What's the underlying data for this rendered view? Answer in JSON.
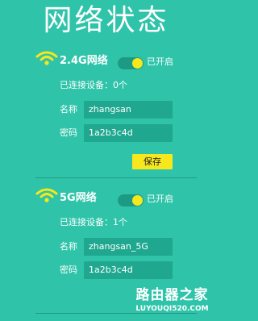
{
  "page": {
    "title": "网络状态"
  },
  "networks": [
    {
      "band_label": "2.4G网络",
      "toggle_status": "已开启",
      "enabled": true,
      "connected_devices": "已连接设备：0个",
      "name_label": "名称",
      "name_value": "zhangsan",
      "password_label": "密码",
      "password_value": "1a2b3c4d",
      "save_label": "保存"
    },
    {
      "band_label": "5G网络",
      "toggle_status": "已开启",
      "enabled": true,
      "connected_devices": "已连接设备：1个",
      "name_label": "名称",
      "name_value": "zhangsan_5G",
      "password_label": "密码",
      "password_value": "1a2b3c4d"
    }
  ],
  "watermark": {
    "text_cn": "路由器之家",
    "text_en": "LUYOUQI520.COM"
  },
  "colors": {
    "background": "#2fc4a9",
    "field": "#1fa88f",
    "accent": "#f6e81c",
    "text": "#ffffff"
  },
  "icons": {
    "wifi": "wifi-icon"
  }
}
